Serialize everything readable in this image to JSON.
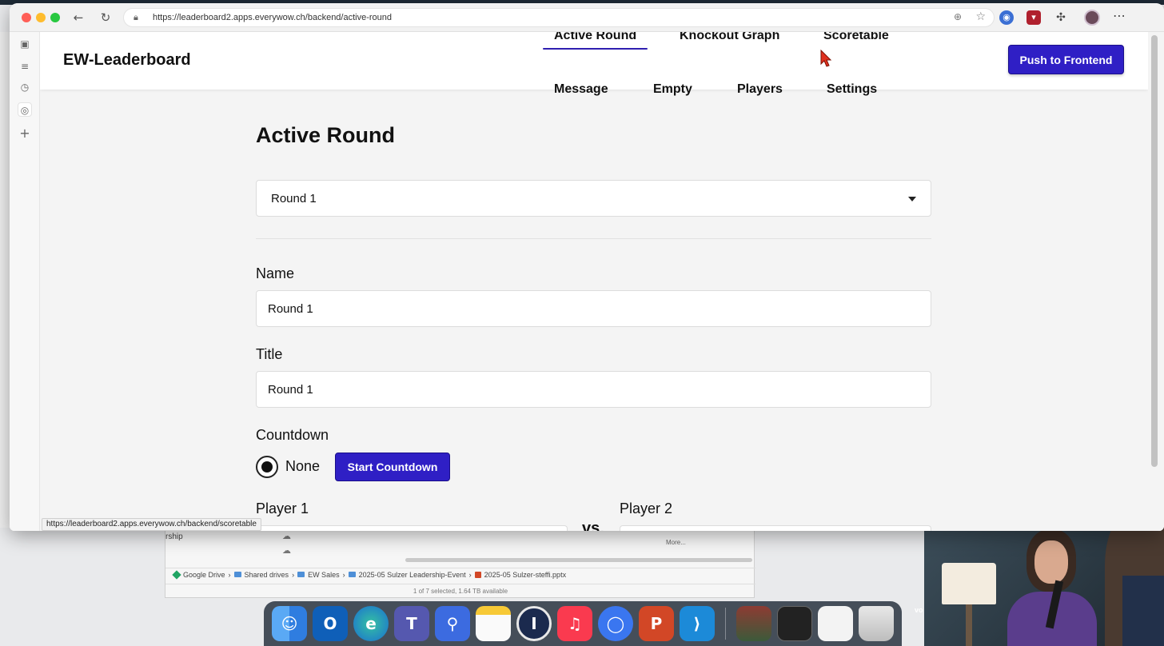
{
  "browser": {
    "url": "https://leaderboard2.apps.everywow.ch/backend/active-round",
    "status_url": "https://leaderboard2.apps.everywow.ch/backend/scoretable"
  },
  "app": {
    "brand": "EW-Leaderboard",
    "push_label": "Push to Frontend",
    "nav": {
      "active_round": "Active Round",
      "knockout_graph": "Knockout Graph",
      "scoretable": "Scoretable",
      "message": "Message",
      "empty": "Empty",
      "players": "Players",
      "settings": "Settings"
    },
    "accent_color": "#2f1fc5"
  },
  "form": {
    "page_title": "Active Round",
    "round_select_value": "Round 1",
    "name_label": "Name",
    "name_value": "Round 1",
    "title_label": "Title",
    "title_value": "Round 1",
    "countdown_label": "Countdown",
    "countdown_option": "None",
    "start_countdown_label": "Start Countdown",
    "player1_label": "Player 1",
    "player2_label": "Player 2",
    "vs_label": "vs."
  },
  "finder": {
    "row_text": "rship",
    "more_label": "More...",
    "path": [
      "Google Drive",
      "Shared drives",
      "EW Sales",
      "2025-05 Sulzer Leadership-Event",
      "2025-05 Sulzer-steffi.pptx"
    ],
    "status": "1 of 7 selected, 1.64 TB available"
  },
  "desktop": {
    "vo_text": "vo"
  },
  "dock": {
    "apps": [
      "finder-icon",
      "outlook-icon",
      "edge-icon",
      "teams-icon",
      "bitwarden-icon",
      "notes-icon",
      "1password-icon",
      "music-icon",
      "signal-icon",
      "powerpoint-icon",
      "vscode-icon"
    ]
  }
}
